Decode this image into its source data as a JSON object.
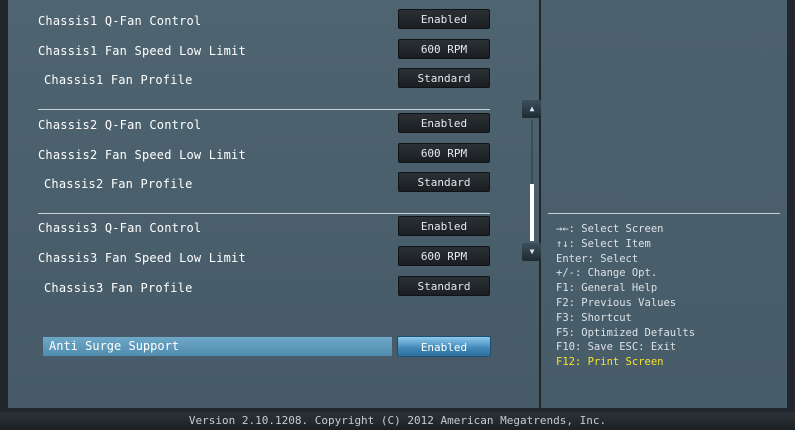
{
  "settings": {
    "chassis1_qfan": {
      "label": "Chassis1 Q-Fan Control",
      "value": "Enabled"
    },
    "chassis1_speed": {
      "label": "Chassis1 Fan Speed Low Limit",
      "value": "600 RPM"
    },
    "chassis1_profile": {
      "label": "Chassis1 Fan Profile",
      "value": "Standard"
    },
    "chassis2_qfan": {
      "label": "Chassis2 Q-Fan Control",
      "value": "Enabled"
    },
    "chassis2_speed": {
      "label": "Chassis2 Fan Speed Low Limit",
      "value": "600 RPM"
    },
    "chassis2_profile": {
      "label": "Chassis2 Fan Profile",
      "value": "Standard"
    },
    "chassis3_qfan": {
      "label": "Chassis3 Q-Fan Control",
      "value": "Enabled"
    },
    "chassis3_speed": {
      "label": "Chassis3 Fan Speed Low Limit",
      "value": "600 RPM"
    },
    "chassis3_profile": {
      "label": "Chassis3 Fan Profile",
      "value": "Standard"
    },
    "anti_surge": {
      "label": "Anti Surge Support",
      "value": "Enabled"
    }
  },
  "scrollbar": {
    "up_icon": "triangle-up-icon",
    "down_icon": "triangle-down-icon"
  },
  "help": {
    "select_screen": "→←: Select Screen",
    "select_item": "↑↓: Select Item",
    "enter": "Enter: Select",
    "change": "+/-: Change Opt.",
    "f1": "F1: General Help",
    "f2": "F2: Previous Values",
    "f3": "F3: Shortcut",
    "f5": "F5: Optimized Defaults",
    "f10": "F10: Save  ESC: Exit",
    "f12": "F12: Print Screen"
  },
  "footer": {
    "text": "Version 2.10.1208. Copyright (C) 2012 American Megatrends, Inc."
  },
  "colors": {
    "highlight": "#f7e32a",
    "selected_bar": "#5c97b8",
    "panel": "#4c616e"
  }
}
